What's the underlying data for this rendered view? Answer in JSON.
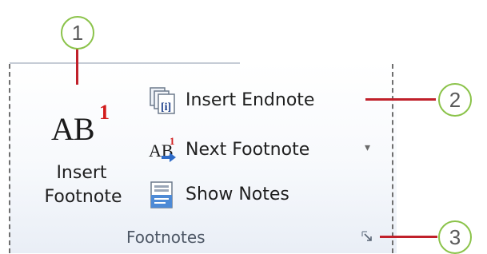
{
  "ribbon_group": {
    "name": "Footnotes",
    "insert_footnote": {
      "icon_text": "AB",
      "icon_superscript": "1",
      "label_line1": "Insert",
      "label_line2": "Footnote"
    },
    "insert_endnote": {
      "label": "Insert Endnote",
      "icon": "endnote-icon"
    },
    "next_footnote": {
      "label": "Next Footnote",
      "icon_text": "AB",
      "icon_superscript": "1",
      "dropdown": "▾"
    },
    "show_notes": {
      "label": "Show Notes",
      "icon": "show-notes-icon"
    },
    "dialog_launcher": {
      "icon": "dialog-launcher-icon"
    }
  },
  "callouts": [
    {
      "number": "1"
    },
    {
      "number": "2"
    },
    {
      "number": "3"
    }
  ],
  "colors": {
    "callout_ring": "#8bc34a",
    "leader_line": "#c0202a",
    "superscript": "#d21c1c"
  }
}
